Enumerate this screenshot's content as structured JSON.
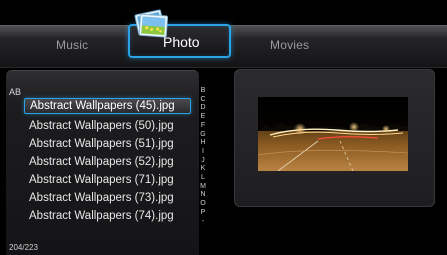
{
  "nav": {
    "items": [
      {
        "label": "Music"
      },
      {
        "label": "Photo"
      },
      {
        "label": "Movies"
      }
    ],
    "selected": "Photo",
    "selected_icon": "photo-stack-icon"
  },
  "list": {
    "group_label": "AB",
    "files": [
      {
        "name": "Abstract Wallpapers (45).jpg",
        "selected": true
      },
      {
        "name": "Abstract Wallpapers (50).jpg",
        "selected": false
      },
      {
        "name": "Abstract Wallpapers (51).jpg",
        "selected": false
      },
      {
        "name": "Abstract Wallpapers (52).jpg",
        "selected": false
      },
      {
        "name": "Abstract Wallpapers (71).jpg",
        "selected": false
      },
      {
        "name": "Abstract Wallpapers (73).jpg",
        "selected": false
      },
      {
        "name": "Abstract Wallpapers (74).jpg",
        "selected": false
      }
    ],
    "alphabet_index": [
      "B",
      "C",
      "D",
      "E",
      "F",
      "G",
      "H",
      "I",
      "J",
      "K",
      "L",
      "M",
      "N",
      "O",
      "P",
      "-"
    ],
    "counter": "204/223"
  },
  "preview": {
    "description_icon": "night-road-photo"
  },
  "colors": {
    "accent": "#2aa3e6",
    "background": "#000000",
    "text": "#e8e8e8"
  }
}
